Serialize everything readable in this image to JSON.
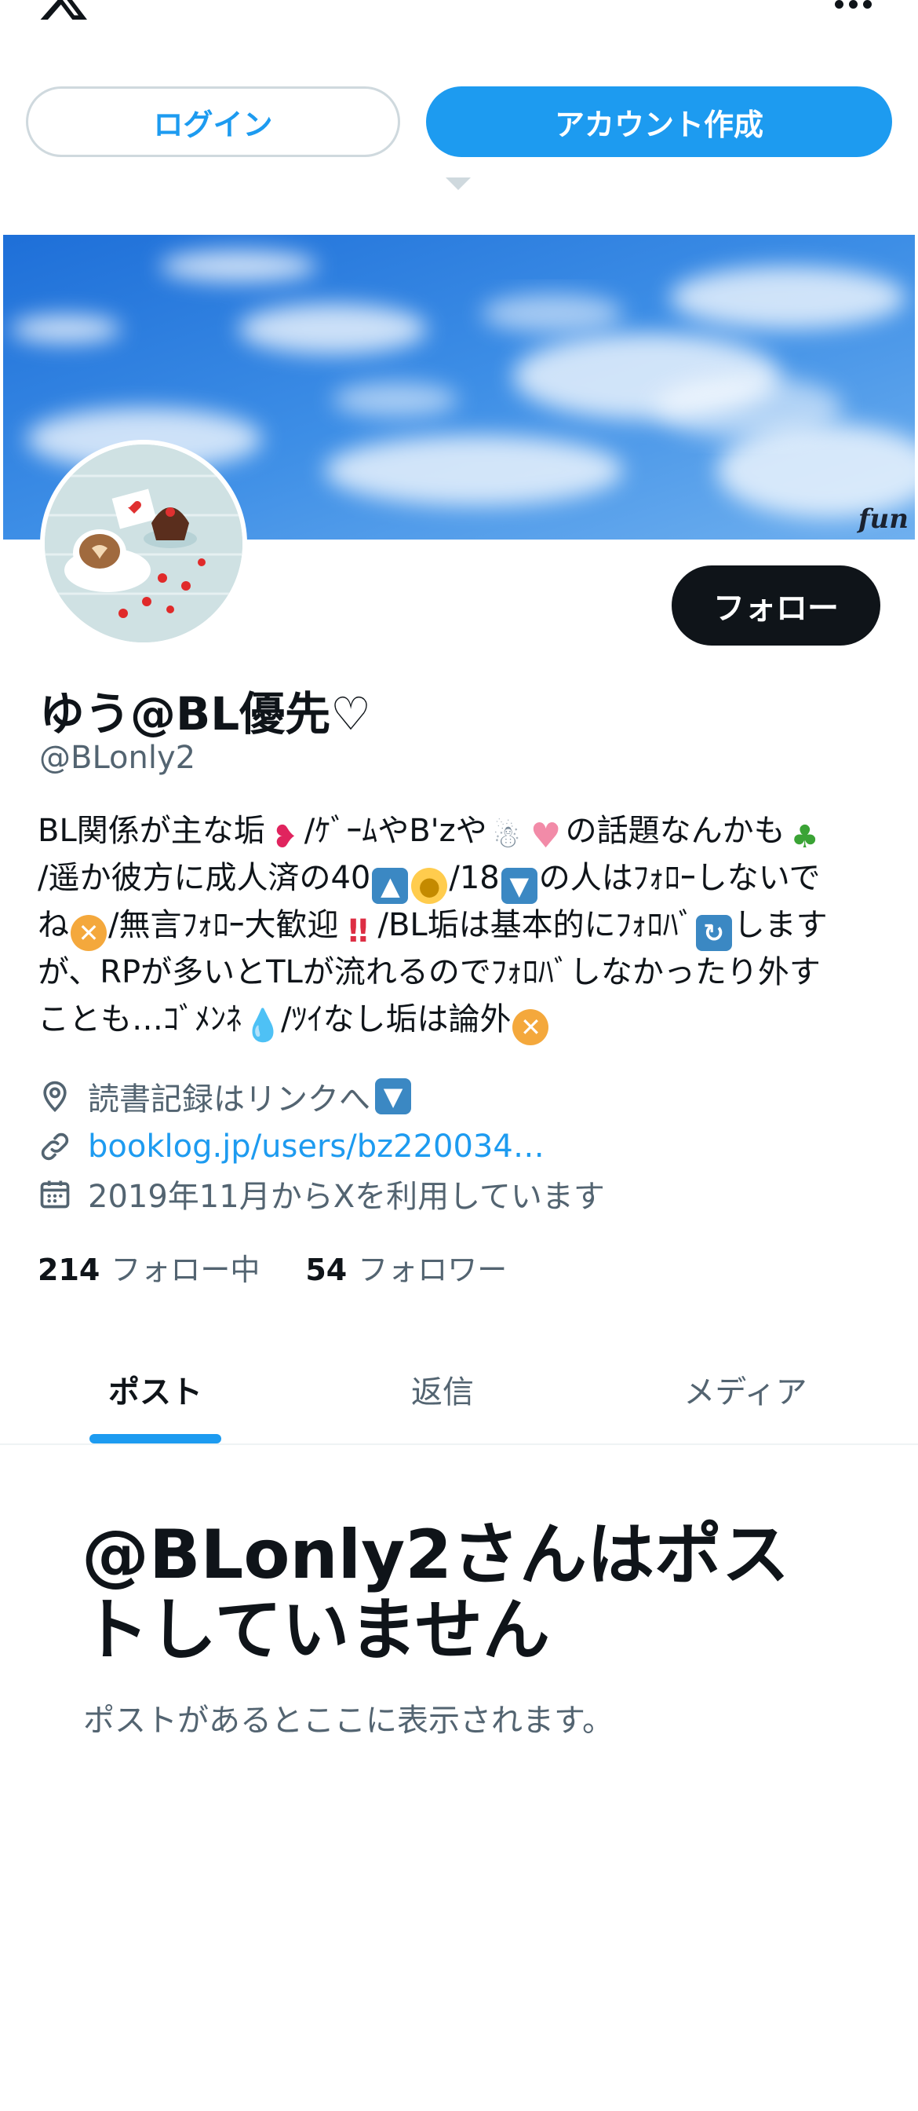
{
  "header": {
    "logo_icon": "x-logo-icon",
    "more_icon": "more-options-icon"
  },
  "auth": {
    "login_label": "ログイン",
    "signup_label": "アカウント作成"
  },
  "banner": {
    "watermark": "fun"
  },
  "profile": {
    "follow_label": "フォロー",
    "display_name": "ゆう@BL優先♡",
    "handle": "@BLonly2",
    "bio_lines": [
      [
        "BL関係が主な垢",
        "/ｹﾞｰﾑやB'zや",
        "",
        "の話題なんかも"
      ],
      [
        "/遥か彼方に成人済の40",
        "",
        "/18",
        "の人はﾌｫﾛｰしないで"
      ],
      [
        "ね",
        "/無言ﾌｫﾛｰ大歓迎",
        "/BL垢は基本的にﾌｫﾛﾊﾞ",
        "します"
      ],
      [
        "が、RPが多いとTLが流れるのでﾌｫﾛﾊﾞしなかったり外す"
      ],
      [
        "ことも…ｺﾞﾒﾝﾈ",
        "/ﾂｲなし垢は論外"
      ]
    ],
    "location": "読書記録はリンクへ",
    "link": "booklog.jp/users/bz220034…",
    "joined": "2019年11月からXを利用しています",
    "following_count": "214",
    "following_label": "フォロー中",
    "followers_count": "54",
    "followers_label": "フォロワー"
  },
  "tabs": [
    {
      "label": "ポスト",
      "active": true
    },
    {
      "label": "返信",
      "active": false
    },
    {
      "label": "メディア",
      "active": false
    }
  ],
  "empty_state": {
    "title": "@BLonly2さんはポストしていません",
    "subtitle": "ポストがあるとここに表示されます。"
  },
  "colors": {
    "accent": "#1d9bf0",
    "text": "#0f1419",
    "muted": "#536471",
    "border": "#cfd9de"
  }
}
